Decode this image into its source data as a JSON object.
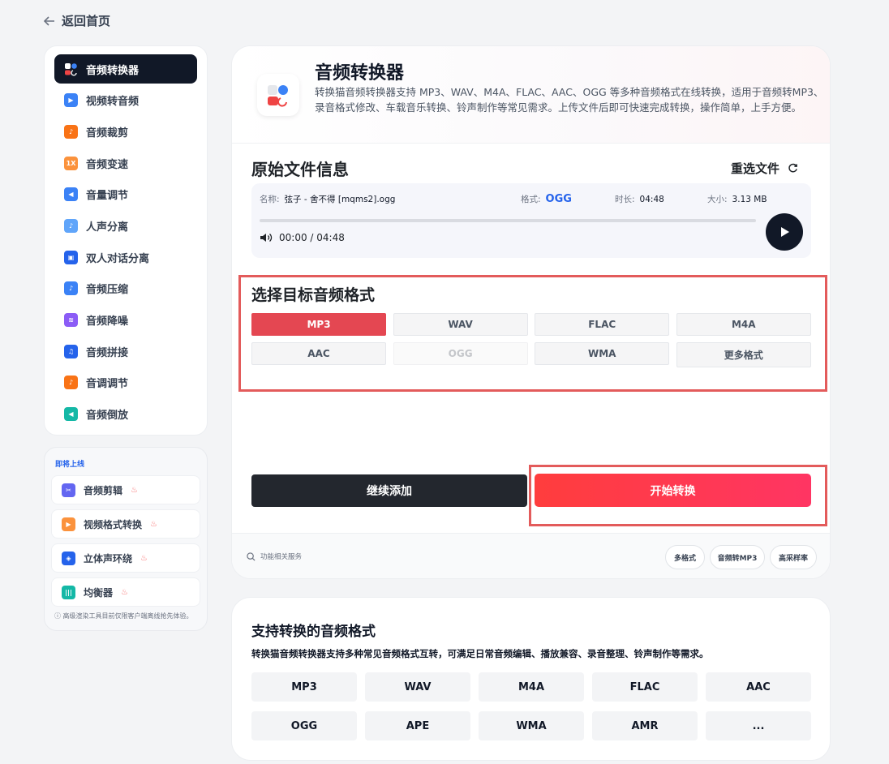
{
  "back_label": "返回首页",
  "sidebar": {
    "items": [
      {
        "label": "音频转换器",
        "color": "#ffffff"
      },
      {
        "label": "视频转音频",
        "color": "#3b82f6"
      },
      {
        "label": "音频裁剪",
        "color": "#f97316"
      },
      {
        "label": "音频变速",
        "color": "#f97316"
      },
      {
        "label": "音量调节",
        "color": "#3b82f6"
      },
      {
        "label": "人声分离",
        "color": "#3b82f6"
      },
      {
        "label": "双人对话分离",
        "color": "#2563eb"
      },
      {
        "label": "音频压缩",
        "color": "#3b82f6"
      },
      {
        "label": "音频降噪",
        "color": "#8b5cf6"
      },
      {
        "label": "音频拼接",
        "color": "#2563eb"
      },
      {
        "label": "音调调节",
        "color": "#f97316"
      },
      {
        "label": "音频倒放",
        "color": "#14b8a6"
      }
    ],
    "speed_badge": "1X"
  },
  "coming_soon": {
    "title": "即将上线",
    "items": [
      {
        "label": "音频剪辑"
      },
      {
        "label": "视频格式转换"
      },
      {
        "label": "立体声环绕"
      },
      {
        "label": "均衡器"
      }
    ],
    "note": "高级渲染工具目前仅限客户端离线抢先体验。"
  },
  "header": {
    "title": "音频转换器",
    "description": "转换猫音频转换器支持 MP3、WAV、M4A、FLAC、AAC、OGG 等多种音频格式在线转换，适用于音频转MP3、录音格式修改、车载音乐转换、铃声制作等常见需求。上传文件后即可快速完成转换，操作简单，上手方便。"
  },
  "file_section": {
    "title": "原始文件信息",
    "reselect_label": "重选文件",
    "name_label": "名称:",
    "name_value": "弦子 - 舍不得 [mqms2].ogg",
    "format_label": "格式:",
    "format_value": "OGG",
    "duration_label": "时长:",
    "duration_value": "04:48",
    "size_label": "大小:",
    "size_value": "3.13 MB",
    "time_display": "00:00 / 04:48",
    "progress": 0
  },
  "format_section": {
    "title": "选择目标音频格式",
    "options": [
      "MP3",
      "WAV",
      "FLAC",
      "M4A",
      "AAC",
      "OGG",
      "WMA",
      "更多格式"
    ],
    "selected": "MP3",
    "disabled": "OGG"
  },
  "actions": {
    "add_label": "继续添加",
    "start_label": "开始转换"
  },
  "footer": {
    "search_placeholder": "功能相关服务",
    "tags": [
      "多格式",
      "音频转MP3",
      "高采样率"
    ]
  },
  "supported": {
    "title": "支持转换的音频格式",
    "description": "转换猫音频转换器支持多种常见音频格式互转，可满足日常音频编辑、播放兼容、录音整理、铃声制作等需求。",
    "formats": [
      "MP3",
      "WAV",
      "M4A",
      "FLAC",
      "AAC",
      "OGG",
      "APE",
      "WMA",
      "AMR",
      "..."
    ]
  },
  "colors": {
    "accent": "#e44752",
    "dark": "#111827",
    "highlight_border": "#e35b5b"
  }
}
